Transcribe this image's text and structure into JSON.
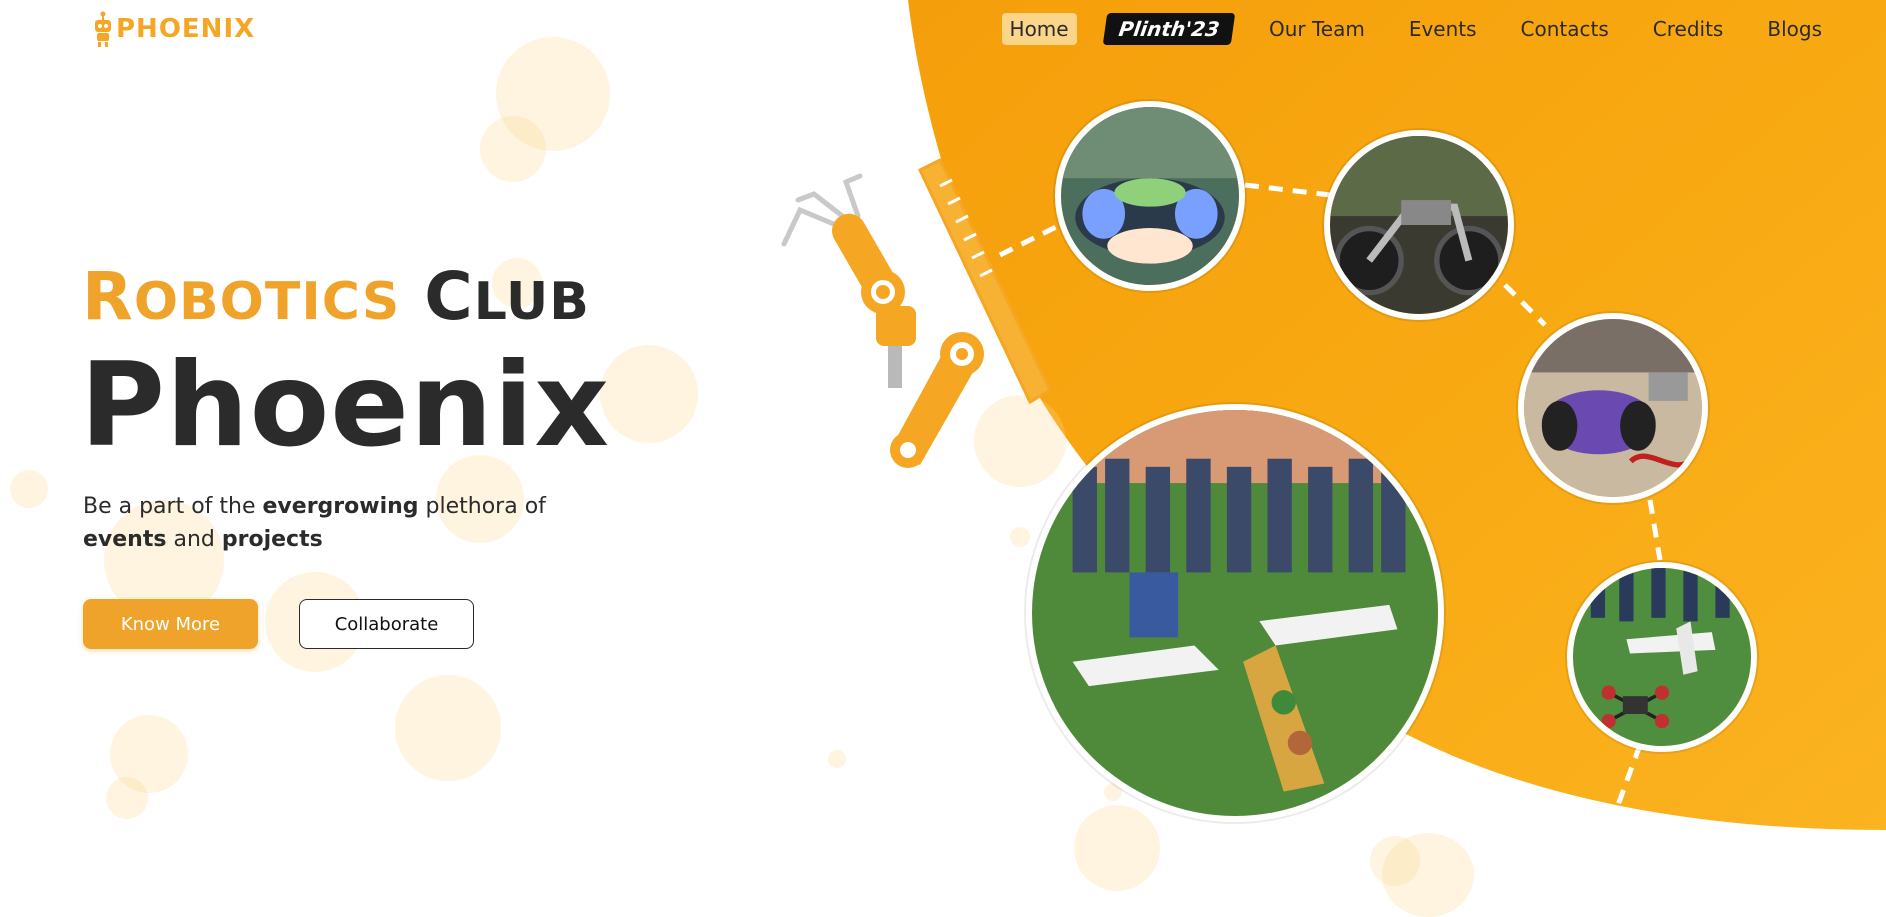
{
  "brand": {
    "logo_text": "PHOENIX",
    "accent": "#f5a623"
  },
  "nav": {
    "items": [
      {
        "label": "Home",
        "active": true
      },
      {
        "label": "Plinth'23",
        "highlight": true
      },
      {
        "label": "Our Team"
      },
      {
        "label": "Events"
      },
      {
        "label": "Contacts"
      },
      {
        "label": "Credits"
      },
      {
        "label": "Blogs"
      }
    ]
  },
  "hero": {
    "word1_cap": "R",
    "word1_rest": "OBOTICS",
    "word2_cap": "C",
    "word2_rest": "LUB",
    "title": "Phoenix",
    "tagline": {
      "p1": "Be a part of the ",
      "b1": "evergrowing",
      "p2": " plethora of ",
      "b2": "events",
      "p3": " and ",
      "b3": "projects"
    }
  },
  "buttons": {
    "primary": "Know More",
    "secondary": "Collaborate"
  },
  "photos": [
    {
      "name": "photo-led-robot-icon"
    },
    {
      "name": "photo-motorbike-icon"
    },
    {
      "name": "photo-drone-group-icon"
    },
    {
      "name": "photo-rc-car-icon"
    },
    {
      "name": "photo-quadcopter-icon"
    }
  ],
  "colors": {
    "orange": "#f7a20e",
    "orange_light": "#fbc02d",
    "text": "#2b2b2b"
  }
}
